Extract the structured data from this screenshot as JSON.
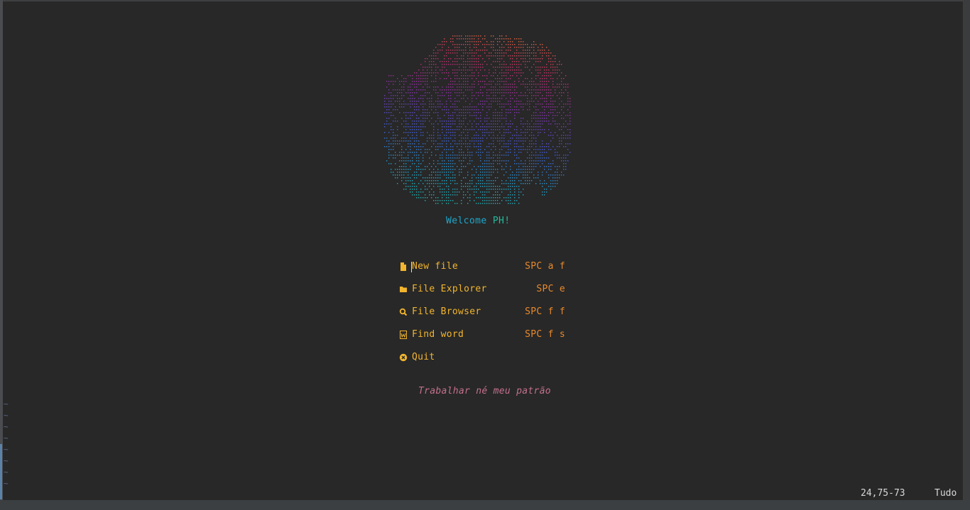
{
  "dashboard": {
    "welcome": {
      "prefix": "Welcome ",
      "name": "PH!"
    },
    "menu": [
      {
        "icon": "file-icon",
        "label": "New file",
        "key": "SPC a f"
      },
      {
        "icon": "folder-icon",
        "label": "File Explorer",
        "key": "SPC e"
      },
      {
        "icon": "search-icon",
        "label": "File Browser",
        "key": "SPC f f"
      },
      {
        "icon": "word-doc-icon",
        "label": "Find word",
        "key": "SPC f s"
      },
      {
        "icon": "close-circle-icon",
        "label": "Quit",
        "key": ""
      }
    ],
    "quote": "Trabalhar né meu patrão"
  },
  "editor": {
    "empty_line_marker": "~",
    "empty_lines": [
      "~",
      "~",
      "~",
      "~",
      "~",
      "~",
      "~",
      "~"
    ]
  },
  "statusline": {
    "position": "24,75-73",
    "scroll": "Tudo"
  },
  "colors": {
    "background": "#282828",
    "menu_label": "#f2b52d",
    "menu_key": "#e8892c",
    "welcome_cyan": "#1fa6c9",
    "welcome_green": "#24b99a",
    "quote": "#c4708e",
    "logo_gradient": [
      "#e8892c",
      "#c9315f",
      "#8a2ea6",
      "#3f5bd6",
      "#1fa6c9",
      "#24b99a"
    ]
  }
}
